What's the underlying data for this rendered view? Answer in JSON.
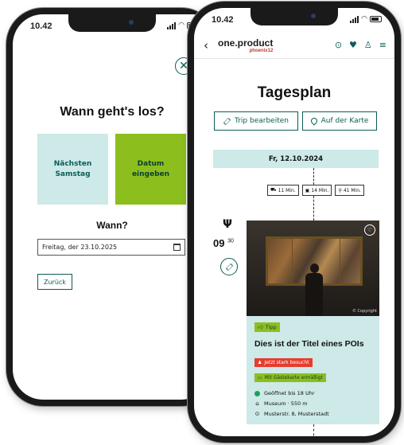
{
  "left_phone": {
    "status": {
      "time": "10.42"
    },
    "title": "Wann geht's los?",
    "options": [
      {
        "label_line1": "Nächsten",
        "label_line2": "Samstag"
      },
      {
        "label_line1": "Datum",
        "label_line2": "eingeben"
      }
    ],
    "when_label": "Wann?",
    "date_field": {
      "value": "Freitag, der 23.10.2025"
    },
    "back_button": "Zurück",
    "colors": {
      "primary": "#0b5d55",
      "light": "#cde9e8",
      "accent": "#8cbf1e"
    }
  },
  "right_phone": {
    "status": {
      "time": "10.42"
    },
    "brand": {
      "name": "one.product",
      "sub": "phoenix12"
    },
    "page_title": "Tagesplan",
    "buttons": {
      "edit_trip": "Trip bearbeiten",
      "on_map": "Auf der Karte"
    },
    "date_bar": "Fr, 12.10.2024",
    "transport": [
      {
        "icon": "car-icon",
        "label": "11 Min."
      },
      {
        "icon": "bus-icon",
        "label": "14 Min."
      },
      {
        "icon": "walk-icon",
        "label": "41 Min."
      }
    ],
    "timeline": {
      "hour": "09",
      "minute": "30"
    },
    "poi": {
      "copyright": "© Copyright",
      "tag": "Tipp",
      "title": "Dies ist der Titel eines POIs",
      "busy_badge": "Jetzt stark besucht",
      "guest_card_badge": "Mit Gästekarte ermäßigt",
      "opening": "Geöffnet bis 18 Uhr",
      "category_distance": "Museum · 550 m",
      "address": "Musterstr. 8, Musterstadt"
    },
    "colors": {
      "busy": "#e53d2f",
      "open": "#1aa35a"
    }
  }
}
